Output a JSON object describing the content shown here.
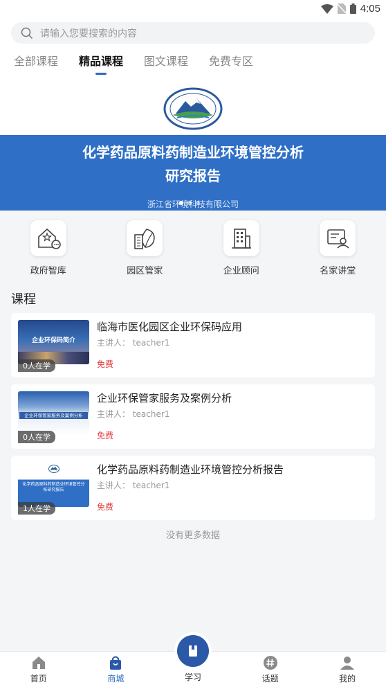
{
  "status": {
    "time": "4:05"
  },
  "search": {
    "placeholder": "请输入您要搜索的内容"
  },
  "tabs": [
    "全部课程",
    "精品课程",
    "图文课程",
    "免费专区"
  ],
  "banner": {
    "title_line1": "化学药品原料药制造业环境管控分析",
    "title_line2": "研究报告",
    "org": "浙江省环境科技有限公司"
  },
  "quicknav": [
    {
      "label": "政府智库",
      "icon": "gov-house-star-icon"
    },
    {
      "label": "园区管家",
      "icon": "building-leaf-icon"
    },
    {
      "label": "企业顾问",
      "icon": "office-building-icon"
    },
    {
      "label": "名家讲堂",
      "icon": "lecture-person-icon"
    }
  ],
  "section": {
    "title": "课程"
  },
  "courses": [
    {
      "title": "临海市医化园区企业环保码应用",
      "teacher": "主讲人： teacher1",
      "price": "免费",
      "learners": "0人在学",
      "thumb_text": "企业环保码简介"
    },
    {
      "title": "企业环保管家服务及案例分析",
      "teacher": "主讲人： teacher1",
      "price": "免费",
      "learners": "0人在学",
      "thumb_text": "企业环保管家服务及案例分析"
    },
    {
      "title": "化学药品原料药制造业环境管控分析报告",
      "teacher": "主讲人： teacher1",
      "price": "免费",
      "learners": "1人在学",
      "thumb_text": "化学药品原料药制造业环境管控分析研究报告"
    }
  ],
  "list_end": "没有更多数据",
  "tabbar": [
    {
      "label": "首页",
      "icon": "home-icon"
    },
    {
      "label": "商城",
      "icon": "shopping-bag-icon"
    },
    {
      "label": "学习",
      "icon": "book-icon"
    },
    {
      "label": "话题",
      "icon": "hashtag-icon"
    },
    {
      "label": "我的",
      "icon": "user-icon"
    }
  ],
  "colors": {
    "accent": "#2b6ac6",
    "banner_blue": "#2f6fc6",
    "price_red": "#e43a3a"
  }
}
